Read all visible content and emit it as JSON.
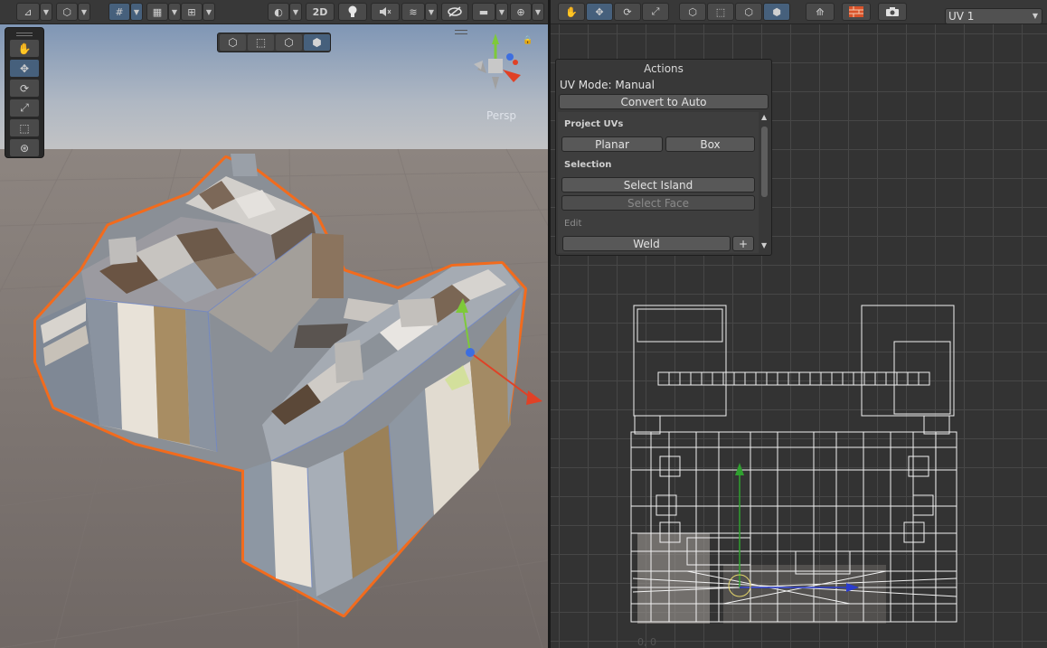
{
  "scene_view": {
    "toolbar": {
      "buttons": [
        {
          "name": "draw-mode-icon",
          "glyph": "⊿",
          "on": false
        },
        {
          "name": "render-mode-icon",
          "glyph": "⬡",
          "on": false
        },
        {
          "name": "grid-snap-icon",
          "glyph": "#",
          "on": true
        },
        {
          "name": "grid-icon",
          "glyph": "▦",
          "on": false
        },
        {
          "name": "ruler-icon",
          "glyph": "⊞",
          "on": false
        },
        {
          "name": "shading-icon",
          "glyph": "◐",
          "on": false
        },
        {
          "name": "2d-toggle",
          "glyph": "2D",
          "on": false
        },
        {
          "name": "lighting-icon",
          "glyph": "●",
          "on": false
        },
        {
          "name": "audio-mute-icon",
          "glyph": "🔇",
          "on": false
        },
        {
          "name": "effects-icon",
          "glyph": "≋",
          "on": false
        },
        {
          "name": "hidden-objects-icon",
          "glyph": "⊘",
          "on": false
        },
        {
          "name": "camera-icon",
          "glyph": "■",
          "on": false
        },
        {
          "name": "gizmos-icon",
          "glyph": "⊕",
          "on": false
        }
      ],
      "label_2d": "2D"
    },
    "tools": [
      {
        "name": "hand-tool",
        "glyph": "✋",
        "on": false
      },
      {
        "name": "move-tool",
        "glyph": "✥",
        "on": true
      },
      {
        "name": "rotate-tool",
        "glyph": "⟳",
        "on": false
      },
      {
        "name": "scale-tool",
        "glyph": "⤢",
        "on": false
      },
      {
        "name": "rect-tool",
        "glyph": "⬚",
        "on": false
      },
      {
        "name": "transform-tool",
        "glyph": "⊛",
        "on": false
      }
    ],
    "select_modes": [
      {
        "name": "object-select-icon",
        "glyph": "⬡",
        "on": false
      },
      {
        "name": "vertex-select-icon",
        "glyph": "⬚",
        "on": false
      },
      {
        "name": "edge-select-icon",
        "glyph": "⬡",
        "on": false
      },
      {
        "name": "face-select-icon",
        "glyph": "⬢",
        "on": true
      }
    ],
    "projection_label": "Persp"
  },
  "uv_editor": {
    "toolbar": {
      "tools": [
        {
          "name": "uv-hand-tool",
          "glyph": "✋",
          "on": false
        },
        {
          "name": "uv-move-tool",
          "glyph": "✥",
          "on": true
        },
        {
          "name": "uv-rotate-tool",
          "glyph": "⟳",
          "on": false
        },
        {
          "name": "uv-scale-tool",
          "glyph": "⤢",
          "on": false
        }
      ],
      "modes": [
        {
          "name": "uv-object-select-icon",
          "glyph": "⬡",
          "on": false
        },
        {
          "name": "uv-vertex-select-icon",
          "glyph": "⬚",
          "on": false
        },
        {
          "name": "uv-edge-select-icon",
          "glyph": "⬡",
          "on": false
        },
        {
          "name": "uv-face-select-icon",
          "glyph": "⬢",
          "on": true
        }
      ],
      "extra": [
        {
          "name": "lightmap-uv-icon",
          "glyph": "⟰"
        },
        {
          "name": "texture-preview-icon",
          "glyph": "▤"
        },
        {
          "name": "screenshot-icon",
          "glyph": "📷"
        }
      ],
      "channel": "UV 1"
    },
    "actions": {
      "title": "Actions",
      "uv_mode": "UV Mode: Manual",
      "convert": "Convert to Auto",
      "project_uvs": "Project UVs",
      "planar": "Planar",
      "box": "Box",
      "selection": "Selection",
      "select_island": "Select Island",
      "select_face": "Select Face",
      "edit": "Edit",
      "weld": "Weld",
      "weld_plus": "+"
    },
    "origin_label": "0, 0"
  },
  "colors": {
    "selection_outline": "#f26b1d",
    "active_tool": "#46607c",
    "axis_x": "#e04126",
    "axis_y": "#7ec93a",
    "axis_z": "#3d6ee0"
  }
}
